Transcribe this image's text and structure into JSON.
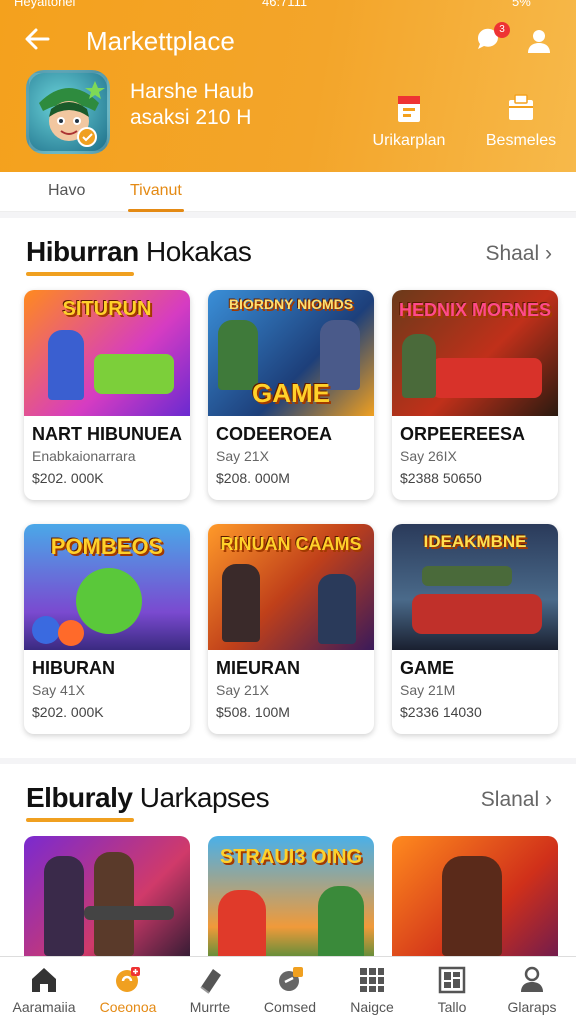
{
  "statusbar": {
    "left": "Heyaitonel",
    "center": "46:7111",
    "right": "5%"
  },
  "header": {
    "title": "Markettplace",
    "notification_count": "3",
    "store_name": "Harshe Haub",
    "store_sub": "asaksi 210 H",
    "actions": [
      {
        "label": "Urikarplan",
        "icon": "clipboard-icon"
      },
      {
        "label": "Besmeles",
        "icon": "folder-icon"
      }
    ]
  },
  "tabs": [
    {
      "label": "Havo",
      "active": false
    },
    {
      "label": "Tivanut",
      "active": true
    }
  ],
  "section1": {
    "title_bold": "Hiburran",
    "title_rest": "Hokakas",
    "see_all": "Shaal",
    "cards": [
      {
        "art_text": "SITURUN",
        "name": "NART HIBUNUEA",
        "sub": "Enabkaionarrara",
        "price": "$202. 000K"
      },
      {
        "art_text": "GAME",
        "art_top": "BIORDNY NIOMDS",
        "name": "CODEEROEA",
        "sub": "Say 21X",
        "price": "$208. 000M"
      },
      {
        "art_text": "HEDNIX MORNES",
        "name": "ORPEEREESA",
        "sub": "Say 26IX",
        "price": "$2388 50650"
      },
      {
        "art_text": "POMBEOS",
        "name": "HIBURAN",
        "sub": "Say 41X",
        "price": "$202. 000K"
      },
      {
        "art_text": "RINUAN CAAMS",
        "name": "MIEURAN",
        "sub": "Say 21X",
        "price": "$508. 100M"
      },
      {
        "art_text": "IDEAKMBNE",
        "name": "GAME",
        "sub": "Say 21M",
        "price": "$2336 14030"
      }
    ]
  },
  "section2": {
    "title_bold": "Elburaly",
    "title_rest": "Uarkapses",
    "see_all": "Slanal",
    "cards": [
      {
        "art_text": ""
      },
      {
        "art_text": "STRAUI3 OING"
      },
      {
        "art_text": ""
      }
    ]
  },
  "bottom_nav": [
    {
      "label": "Aaramaiia",
      "icon": "home-icon",
      "active": false
    },
    {
      "label": "Coeonoa",
      "icon": "game-controller-icon",
      "active": true
    },
    {
      "label": "Murrte",
      "icon": "tag-icon",
      "active": false
    },
    {
      "label": "Comsed",
      "icon": "link-icon",
      "active": false
    },
    {
      "label": "Naigce",
      "icon": "grid-icon",
      "active": false
    },
    {
      "label": "Tallo",
      "icon": "layout-icon",
      "active": false
    },
    {
      "label": "Glaraps",
      "icon": "profile-icon",
      "active": false
    }
  ],
  "colors": {
    "accent": "#e48a14",
    "header": "#f4a11d",
    "badge": "#e33333"
  }
}
